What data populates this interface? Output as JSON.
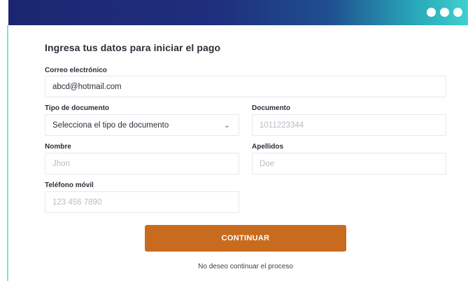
{
  "form": {
    "title": "Ingresa tus datos para iniciar el pago",
    "email": {
      "label": "Correo electrónico",
      "value": "abcd@hotmail.com"
    },
    "document_type": {
      "label": "Tipo de documento",
      "value": "Selecciona el tipo de documento"
    },
    "document": {
      "label": "Documento",
      "placeholder": "1011223344"
    },
    "first_name": {
      "label": "Nombre",
      "placeholder": "Jhon"
    },
    "last_name": {
      "label": "Apellidos",
      "placeholder": "Doe"
    },
    "phone": {
      "label": "Teléfono móvil",
      "placeholder": "123 456 7890"
    },
    "continue_label": "CONTINUAR",
    "cancel_label": "No deseo continuar el proceso"
  },
  "icons": {
    "menu": "more-dots-icon",
    "select": "chevron-down-icon"
  },
  "colors": {
    "accent": "#c96b1f",
    "header_start": "#1c2670",
    "header_end": "#3fd0cf"
  }
}
